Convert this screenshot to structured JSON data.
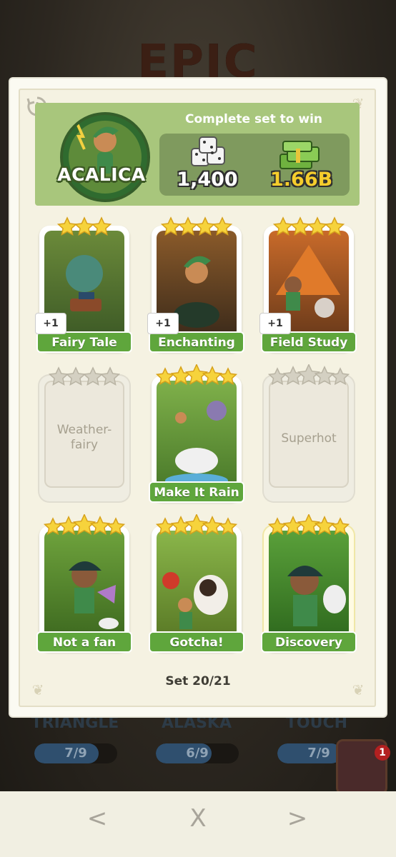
{
  "background": {
    "title": "EPIC",
    "sets": [
      {
        "name": "TRIANGLE",
        "progress": "7/9",
        "fraction": 0.78
      },
      {
        "name": "ALASKA",
        "progress": "6/9",
        "fraction": 0.67
      },
      {
        "name": "TOUCH",
        "progress": "7/9",
        "fraction": 0.78
      }
    ],
    "album_badge": "1"
  },
  "header": {
    "set_name": "ACALICA",
    "complete_label": "Complete set to win",
    "dice_reward": "1,400",
    "cash_reward": "1.66B"
  },
  "cards": [
    {
      "name": "Fairy Tale",
      "stars": 3,
      "owned": true,
      "extra": "+1"
    },
    {
      "name": "Enchanting",
      "stars": 4,
      "owned": true,
      "extra": "+1"
    },
    {
      "name": "Field Study",
      "stars": 4,
      "owned": true,
      "extra": "+1"
    },
    {
      "name": "Weather-\nfairy",
      "stars": 4,
      "owned": false
    },
    {
      "name": "Make It Rain",
      "stars": 5,
      "owned": true
    },
    {
      "name": "Superhot",
      "stars": 5,
      "owned": false
    },
    {
      "name": "Not a fan",
      "stars": 5,
      "owned": true
    },
    {
      "name": "Gotcha!",
      "stars": 5,
      "owned": true
    },
    {
      "name": "Discovery",
      "stars": 5,
      "owned": true,
      "gold": true
    }
  ],
  "footer": {
    "set_progress": "Set 20/21"
  },
  "nav": {
    "prev": "<",
    "close": "X",
    "next": ">"
  },
  "colors": {
    "label_green": "#5fa63c",
    "header_green": "#a8c67c",
    "star_yellow": "#f6d33c"
  }
}
